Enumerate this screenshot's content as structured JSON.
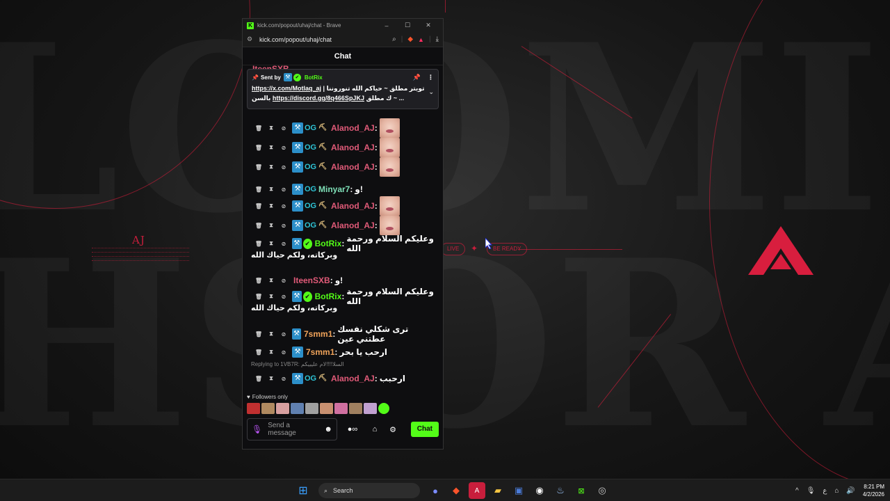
{
  "window": {
    "title": "kick.com/popout/uhaj/chat - Brave",
    "url": "kick.com/popout/uhaj/chat",
    "controls": {
      "minimize": "–",
      "maximize": "☐",
      "close": "✕"
    }
  },
  "desktop": {
    "aj_label": "AJ",
    "pill_left": "LIVE",
    "pill_right": "BE READY"
  },
  "chat": {
    "header": "Chat",
    "pinned": {
      "sent_by_label": "Sent by",
      "bot_name": "BotRix",
      "line1_link": "https://x.com/Motlaq_aj",
      "line1_text": "| تويتر مطلق ~ حياكم الله تنوروننا",
      "line2_text": "بالسن",
      "line2_link": "https://discord.gg/8q466SpJKJ",
      "line2_tail": "ك مطلق ~ ..."
    },
    "messages": [
      {
        "user": "Alanod_AJ",
        "color": "#e05a78",
        "badges": [
          "sword",
          "og",
          "crown"
        ],
        "emote": true
      },
      {
        "user": "Alanod_AJ",
        "color": "#e05a78",
        "badges": [
          "sword",
          "og",
          "crown"
        ],
        "emote": true
      },
      {
        "user": "Alanod_AJ",
        "color": "#e05a78",
        "badges": [
          "sword",
          "og",
          "crown"
        ],
        "emote": true
      },
      {
        "user": "Minyar7",
        "color": "#7fe0b8",
        "badges": [
          "sword",
          "og"
        ],
        "text": "و!"
      },
      {
        "user": "Alanod_AJ",
        "color": "#e05a78",
        "badges": [
          "sword",
          "og",
          "crown"
        ],
        "emote": true
      },
      {
        "user": "Alanod_AJ",
        "color": "#e05a78",
        "badges": [
          "sword",
          "og",
          "crown"
        ],
        "emote": true
      },
      {
        "user": "BotRix",
        "color": "#53fc18",
        "badges": [
          "sword",
          "verified"
        ],
        "text": "وعليكم السلام ورحمة الله",
        "text2": "وبركاته، ولكم حياك الله"
      },
      {
        "user": "IteenSXB",
        "color": "#e05a78",
        "badges": [],
        "text": "و!"
      },
      {
        "user": "BotRix",
        "color": "#53fc18",
        "badges": [
          "sword",
          "verified"
        ],
        "text": "وعليكم السلام ورحمة الله",
        "text2": "وبركاته، ولكم حياك الله"
      },
      {
        "user": "7smm1",
        "color": "#f0a35a",
        "badges": [
          "sword"
        ],
        "text": "ترى شكلي نفسك عطتني عين"
      },
      {
        "user": "7smm1",
        "color": "#f0a35a",
        "badges": [
          "sword"
        ],
        "text": "ارحب يا بحر"
      },
      {
        "reply_to": "Replying to 1VB7R: السلا!!!!لام عليييكم"
      },
      {
        "user": "Alanod_AJ",
        "color": "#e05a78",
        "badges": [
          "sword",
          "og",
          "crown"
        ],
        "text": "ارحبب"
      }
    ],
    "followers_only": "Followers only",
    "input_placeholder": "Send a message",
    "chat_button": "Chat"
  },
  "taskbar": {
    "search_label": "Search",
    "time": "8:21 PM",
    "date": "4/2/2026",
    "lang": "ع"
  },
  "colors": {
    "kick_green": "#53fc18",
    "brand_red": "#c81e3c"
  }
}
